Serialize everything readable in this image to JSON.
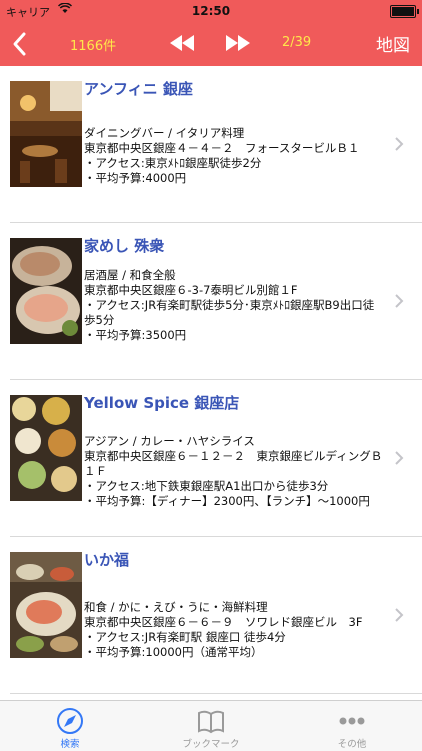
{
  "status_bar": {
    "carrier": "キャリア",
    "time": "12:50"
  },
  "nav": {
    "count": "1166件",
    "page": "2/39",
    "map_label": "地図"
  },
  "items": [
    {
      "name": "アンフィニ 銀座",
      "genre": "ダイニングバー / イタリア料理",
      "address": "東京都中央区銀座４－４－２　フォースタービルＢ１",
      "access": "・アクセス:東京ﾒﾄﾛ銀座駅徒歩2分",
      "budget": "・平均予算:4000円"
    },
    {
      "name": "家めし 殊衆",
      "genre": "居酒屋 / 和食全般",
      "address": "東京都中央区銀座６-3-7泰明ビル別館１F",
      "access": "・アクセス:JR有楽町駅徒歩5分･東京ﾒﾄﾛ銀座駅B9出口徒歩5分",
      "budget": "・平均予算:3500円"
    },
    {
      "name": "Yellow Spice 銀座店",
      "genre": "アジアン / カレー・ハヤシライス",
      "address": "東京都中央区銀座６－１２－２　東京銀座ビルディングＢ１Ｆ",
      "access": "・アクセス:地下鉄東銀座駅A1出口から徒歩3分",
      "budget": "・平均予算:【ディナー】2300円、【ランチ】～1000円"
    },
    {
      "name": "いか福",
      "genre": "和食 / かに・えび・うに・海鮮料理",
      "address": "東京都中央区銀座６－６－９　ソワレド銀座ビル　3F",
      "access": "・アクセス:JR有楽町駅 銀座口 徒歩4分",
      "budget": "・平均予算:10000円（通常平均）"
    }
  ],
  "tabs": [
    {
      "label": "検索",
      "icon": "compass-icon",
      "active": true
    },
    {
      "label": "ブックマーク",
      "icon": "book-icon",
      "active": false
    },
    {
      "label": "その他",
      "icon": "more-icon",
      "active": false
    }
  ],
  "colors": {
    "nav_bg": "#f05a5a",
    "nav_accent": "#ffe84a",
    "link": "#3a55b6",
    "tab_active": "#3478f6",
    "tab_inactive": "#9a9a9a"
  }
}
